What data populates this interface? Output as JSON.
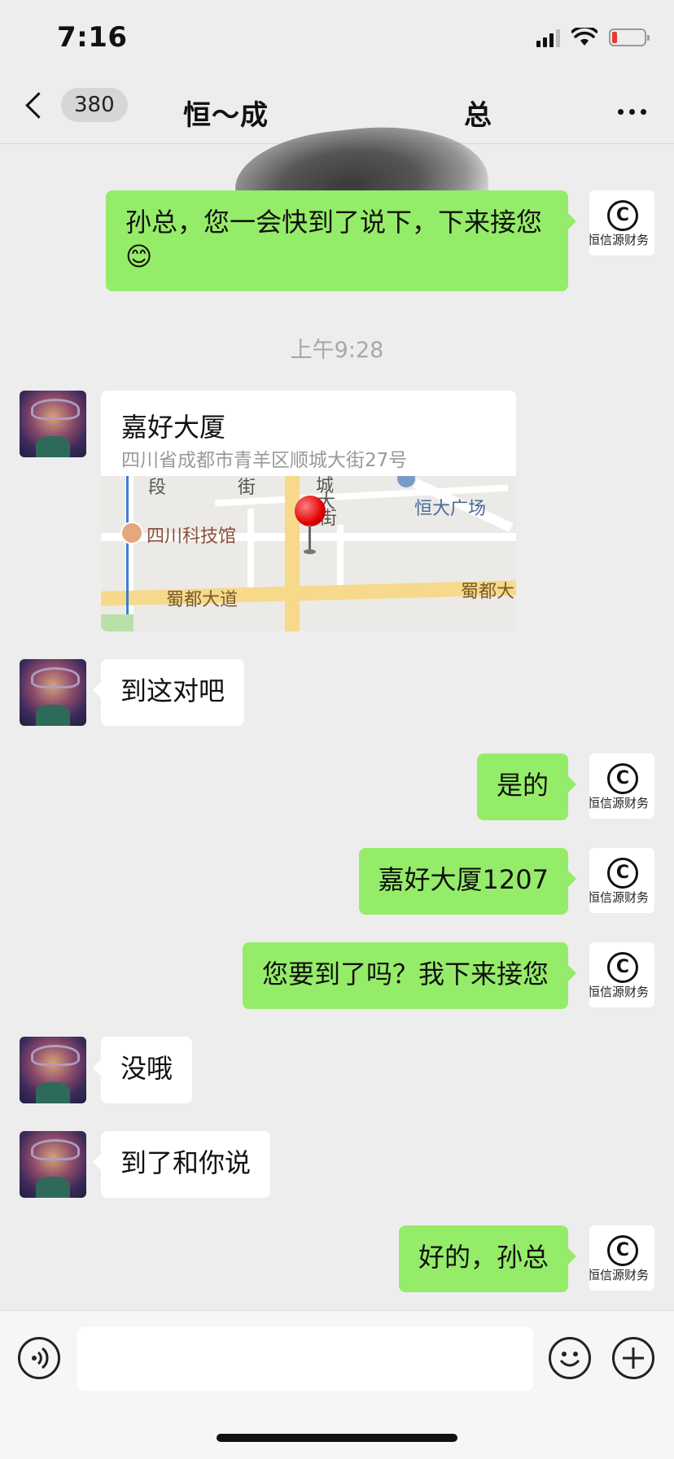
{
  "status_bar": {
    "time": "7:16",
    "battery_level": 0.15,
    "icons": [
      "signal-icon",
      "wifi-icon",
      "battery-icon"
    ]
  },
  "nav": {
    "unread_count": "380",
    "title_prefix": "恒～成",
    "title_suffix": "总",
    "back_icon": "chevron-left-icon",
    "more_icon": "more-dots-icon"
  },
  "messages": [
    {
      "from": "me",
      "text": "孙总，您一会快到了说下，下来接您😊",
      "avatar_label": "恒信源财务"
    },
    {
      "from": "system",
      "text": "上午9:28"
    },
    {
      "from": "them",
      "type": "location",
      "name": "嘉好大厦",
      "address": "四川省成都市青羊区顺城大街27号",
      "map_labels": [
        "恒大广场",
        "四川科技馆",
        "蜀都大道",
        "蜀都大",
        "街",
        "城",
        "大",
        "街",
        "段"
      ]
    },
    {
      "from": "them",
      "text": "到这对吧"
    },
    {
      "from": "me",
      "text": "是的",
      "avatar_label": "恒信源财务"
    },
    {
      "from": "me",
      "text": "嘉好大厦1207",
      "avatar_label": "恒信源财务"
    },
    {
      "from": "me",
      "text": "您要到了吗？我下来接您",
      "avatar_label": "恒信源财务"
    },
    {
      "from": "them",
      "text": "没哦"
    },
    {
      "from": "them",
      "text": "到了和你说"
    },
    {
      "from": "me",
      "text": "好的，孙总",
      "avatar_label": "恒信源财务"
    }
  ],
  "input_bar": {
    "placeholder": "",
    "icons": [
      "voice-icon",
      "emoji-icon",
      "plus-icon"
    ]
  },
  "colors": {
    "background": "#ededed",
    "my_bubble": "#95ec69",
    "their_bubble": "#ffffff",
    "timestamp": "#a8a8a8"
  }
}
